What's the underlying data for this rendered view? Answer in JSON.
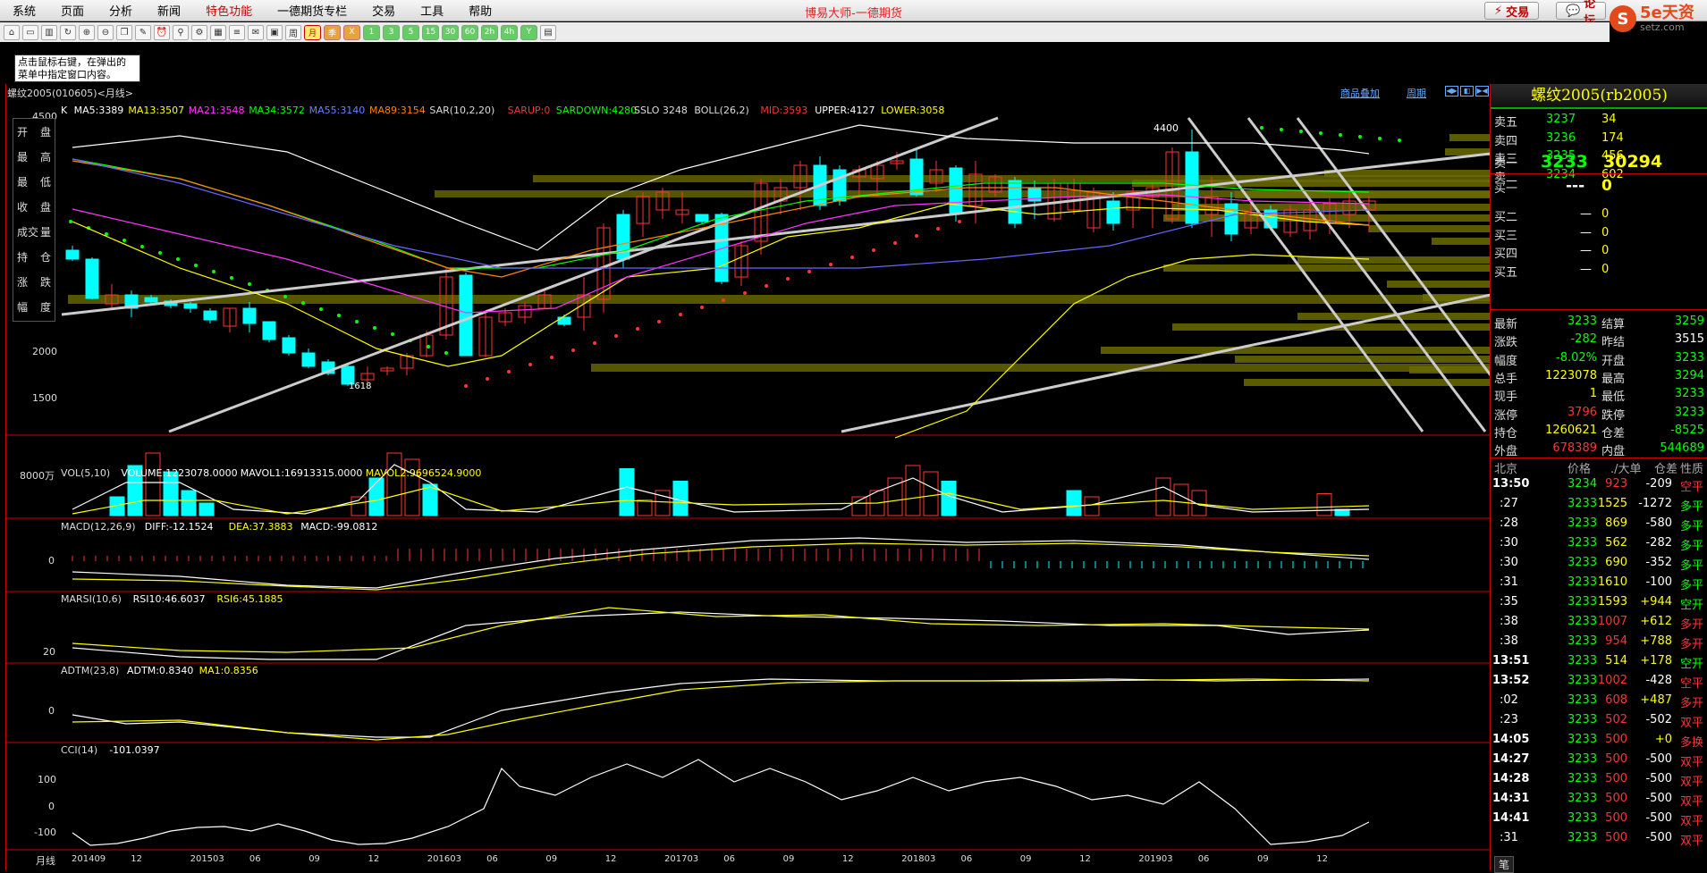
{
  "app_title": "博易大师-一德期货",
  "menu": [
    "系统",
    "页面",
    "分析",
    "新闻",
    "特色功能",
    "一德期货专栏",
    "交易",
    "工具",
    "帮助"
  ],
  "menu_special_index": 4,
  "top_buttons": {
    "trade": "交易",
    "forum": "论坛"
  },
  "logo": {
    "mark": "S",
    "text": "5e天资",
    "sub": "setz.com"
  },
  "toolbar": {
    "periods": [
      "月",
      "季",
      "X",
      "1",
      "3",
      "5",
      "15",
      "30",
      "60",
      "2h",
      "4h",
      "Y"
    ],
    "active_period": "月"
  },
  "hint_text": [
    "点击鼠标右键，在弹出的",
    "菜单中指定窗口内容。"
  ],
  "chart_header": {
    "contract": "螺纹2005(010605)<月线>",
    "overlay": "商品叠加",
    "period": "周期"
  },
  "left_panel": [
    [
      "开",
      "盘"
    ],
    [
      "最",
      "高"
    ],
    [
      "最",
      "低"
    ],
    [
      "收",
      "盘"
    ],
    [
      "成交",
      "量"
    ],
    [
      "持",
      "仓"
    ],
    [
      "涨",
      "跌"
    ],
    [
      "幅",
      "度"
    ]
  ],
  "price_indicators": [
    {
      "text": "K",
      "color": "#ffffff"
    },
    {
      "text": "MA5:3389",
      "color": "#ffffff"
    },
    {
      "text": "MA13:3507",
      "color": "#ffff00"
    },
    {
      "text": "MA21:3548",
      "color": "#ff33ff"
    },
    {
      "text": "MA34:3572",
      "color": "#00ff00"
    },
    {
      "text": "MA55:3140",
      "color": "#6680ff"
    },
    {
      "text": "MA89:3154",
      "color": "#ff8000"
    },
    {
      "text": "SAR(10,2,20)",
      "color": "#dddddd"
    },
    {
      "text": "SARUP:0",
      "color": "#ff3333"
    },
    {
      "text": "SARDOWN:4280",
      "color": "#00ff00"
    },
    {
      "text": "SSLO 3248",
      "color": "#dddddd"
    },
    {
      "text": "BOLL(26,2)",
      "color": "#dddddd"
    },
    {
      "text": "MID:3593",
      "color": "#ff3333"
    },
    {
      "text": "UPPER:4127",
      "color": "#ffffff"
    },
    {
      "text": "LOWER:3058",
      "color": "#ffff00"
    }
  ],
  "price_axis": [
    "4500",
    "2000",
    "1500"
  ],
  "price_marker": "4400",
  "price_low_marker": "1618",
  "vol_labels": [
    {
      "text": "VOL(5,10)",
      "color": "#dddddd"
    },
    {
      "text": "VOLUME:1223078.0000",
      "color": "#ffffff"
    },
    {
      "text": "MAVOL1:16913315.0000",
      "color": "#ffffff"
    },
    {
      "text": "MAVOL2:9696524.9000",
      "color": "#ffff00"
    }
  ],
  "vol_axis": "8000万",
  "macd_labels": [
    {
      "text": "MACD(12,26,9)",
      "color": "#dddddd"
    },
    {
      "text": "DIFF:-12.1524",
      "color": "#ffffff"
    },
    {
      "text": "DEA:37.3883",
      "color": "#ffff00"
    },
    {
      "text": "MACD:-99.0812",
      "color": "#ffffff"
    }
  ],
  "macd_axis": "0",
  "rsi_labels": [
    {
      "text": "MARSI(10,6)",
      "color": "#dddddd"
    },
    {
      "text": "RSI10:46.6037",
      "color": "#ffffff"
    },
    {
      "text": "RSI6:45.1885",
      "color": "#ffff00"
    }
  ],
  "rsi_axis": "20",
  "adtm_labels": [
    {
      "text": "ADTM(23,8)",
      "color": "#dddddd"
    },
    {
      "text": "ADTM:0.8340",
      "color": "#ffffff"
    },
    {
      "text": "MA1:0.8356",
      "color": "#ffff00"
    }
  ],
  "adtm_axis": "0",
  "cci_labels": [
    {
      "text": "CCI(14)",
      "color": "#dddddd"
    },
    {
      "text": "-101.0397",
      "color": "#ffffff"
    }
  ],
  "cci_axis": [
    "100",
    "0",
    "-100"
  ],
  "x_axis_label": "月线",
  "x_dates": [
    "201409",
    "12",
    "201503",
    "06",
    "09",
    "12",
    "201603",
    "06",
    "09",
    "12",
    "201703",
    "06",
    "09",
    "12",
    "201803",
    "06",
    "09",
    "12",
    "201903",
    "06",
    "09",
    "12"
  ],
  "quote": {
    "title": "螺纹2005(rb2005)",
    "asks": [
      {
        "label": "卖五",
        "price": "3237",
        "vol": "34"
      },
      {
        "label": "卖四",
        "price": "3236",
        "vol": "174"
      },
      {
        "label": "卖三",
        "price": "3235",
        "vol": "456"
      },
      {
        "label": "卖二",
        "price": "3234",
        "vol": "602"
      },
      {
        "label": "卖一",
        "price": "3233",
        "vol": "30294"
      }
    ],
    "bids": [
      {
        "label": "买一",
        "price": "---",
        "vol": "0"
      },
      {
        "label": "买二",
        "price": "—",
        "vol": "0"
      },
      {
        "label": "买三",
        "price": "—",
        "vol": "0"
      },
      {
        "label": "买四",
        "price": "—",
        "vol": "0"
      },
      {
        "label": "买五",
        "price": "—",
        "vol": "0"
      }
    ],
    "stats": [
      {
        "l1": "最新",
        "v1": "3233",
        "c1": "green",
        "l2": "结算",
        "v2": "3259",
        "c2": "green"
      },
      {
        "l1": "涨跌",
        "v1": "-282",
        "c1": "green",
        "l2": "昨结",
        "v2": "3515",
        "c2": "white"
      },
      {
        "l1": "幅度",
        "v1": "-8.02%",
        "c1": "green",
        "l2": "开盘",
        "v2": "3233",
        "c2": "green"
      },
      {
        "l1": "总手",
        "v1": "1223078",
        "c1": "yellow",
        "l2": "最高",
        "v2": "3294",
        "c2": "green"
      },
      {
        "l1": "现手",
        "v1": "1",
        "c1": "yellow",
        "l2": "最低",
        "v2": "3233",
        "c2": "green"
      },
      {
        "l1": "涨停",
        "v1": "3796",
        "c1": "red",
        "l2": "跌停",
        "v2": "3233",
        "c2": "green"
      },
      {
        "l1": "持仓",
        "v1": "1260621",
        "c1": "yellow",
        "l2": "仓差",
        "v2": "-8525",
        "c2": "green"
      },
      {
        "l1": "外盘",
        "v1": "678389",
        "c1": "red",
        "l2": "内盘",
        "v2": "544689",
        "c2": "green"
      }
    ],
    "tick_header": {
      "city": "北京",
      "price": "价格",
      "vol": "./大单",
      "oi": "仓差",
      "nature": "性质"
    },
    "ticks": [
      {
        "time": "13:50",
        "price": "3234",
        "vol": "923",
        "oi": "-209",
        "nature": "空平",
        "nc": "red"
      },
      {
        "time": ":27",
        "price": "3233",
        "vol": "1525",
        "oi": "-1272",
        "nature": "多平",
        "nc": "green"
      },
      {
        "time": ":28",
        "price": "3233",
        "vol": "869",
        "oi": "-580",
        "nature": "多平",
        "nc": "green"
      },
      {
        "time": ":30",
        "price": "3233",
        "vol": "562",
        "oi": "-282",
        "nature": "多平",
        "nc": "green"
      },
      {
        "time": ":30",
        "price": "3233",
        "vol": "690",
        "oi": "-352",
        "nature": "多平",
        "nc": "green"
      },
      {
        "time": ":31",
        "price": "3233",
        "vol": "1610",
        "oi": "-100",
        "nature": "多平",
        "nc": "green"
      },
      {
        "time": ":35",
        "price": "3233",
        "vol": "1593",
        "oi": "+944",
        "nature": "空开",
        "nc": "green"
      },
      {
        "time": ":38",
        "price": "3233",
        "vol": "1007",
        "oi": "+612",
        "nature": "多开",
        "nc": "red"
      },
      {
        "time": ":38",
        "price": "3233",
        "vol": "954",
        "oi": "+788",
        "nature": "多开",
        "nc": "red"
      },
      {
        "time": "13:51",
        "price": "3233",
        "vol": "514",
        "oi": "+178",
        "nature": "空开",
        "nc": "green"
      },
      {
        "time": "13:52",
        "price": "3233",
        "vol": "1002",
        "oi": "-428",
        "nature": "空平",
        "nc": "red"
      },
      {
        "time": ":02",
        "price": "3233",
        "vol": "608",
        "oi": "+487",
        "nature": "多开",
        "nc": "red"
      },
      {
        "time": ":23",
        "price": "3233",
        "vol": "502",
        "oi": "-502",
        "nature": "双平",
        "nc": "red"
      },
      {
        "time": "14:05",
        "price": "3233",
        "vol": "500",
        "oi": "+0",
        "nature": "多换",
        "nc": "red"
      },
      {
        "time": "14:27",
        "price": "3233",
        "vol": "500",
        "oi": "-500",
        "nature": "双平",
        "nc": "red"
      },
      {
        "time": "14:28",
        "price": "3233",
        "vol": "500",
        "oi": "-500",
        "nature": "双平",
        "nc": "red"
      },
      {
        "time": "14:31",
        "price": "3233",
        "vol": "500",
        "oi": "-500",
        "nature": "双平",
        "nc": "red"
      },
      {
        "time": "14:41",
        "price": "3233",
        "vol": "500",
        "oi": "-500",
        "nature": "双平",
        "nc": "red"
      },
      {
        "time": ":31",
        "price": "3233",
        "vol": "500",
        "oi": "-500",
        "nature": "双平",
        "nc": "red"
      }
    ],
    "footer_tab": "笔"
  },
  "colors": {
    "up": "#ff3333",
    "down": "#00ffff",
    "grid": "#c00000",
    "volume_profile": "#6b6b00"
  }
}
